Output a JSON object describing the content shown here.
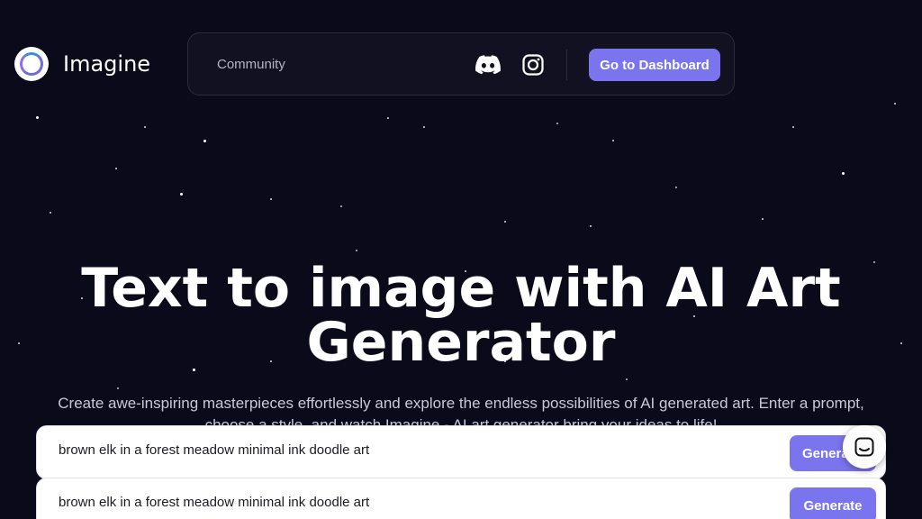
{
  "brand": {
    "name": "Imagine"
  },
  "nav": {
    "community_label": "Community",
    "icons": [
      "discord-icon",
      "instagram-icon"
    ],
    "dashboard_label": "Go to Dashboard"
  },
  "hero": {
    "title_line1": "Text to image with AI Art",
    "title_line2": "Generator",
    "subtitle": "Create awe-inspiring masterpieces effortlessly and explore the endless possibilities of AI generated art. Enter a prompt, choose a style, and watch Imagine - AI art generator bring your ideas to life!"
  },
  "prompts": [
    {
      "value": "brown elk in a forest meadow minimal ink doodle art",
      "button_label": "Generate"
    },
    {
      "value": "brown elk in a forest meadow minimal ink doodle art",
      "button_label": "Generate"
    }
  ],
  "colors": {
    "background": "#0b0a1a",
    "accent": "#7b74ef",
    "nav_bg": "#121122"
  },
  "chat_widget": {
    "icon": "chat-icon"
  }
}
